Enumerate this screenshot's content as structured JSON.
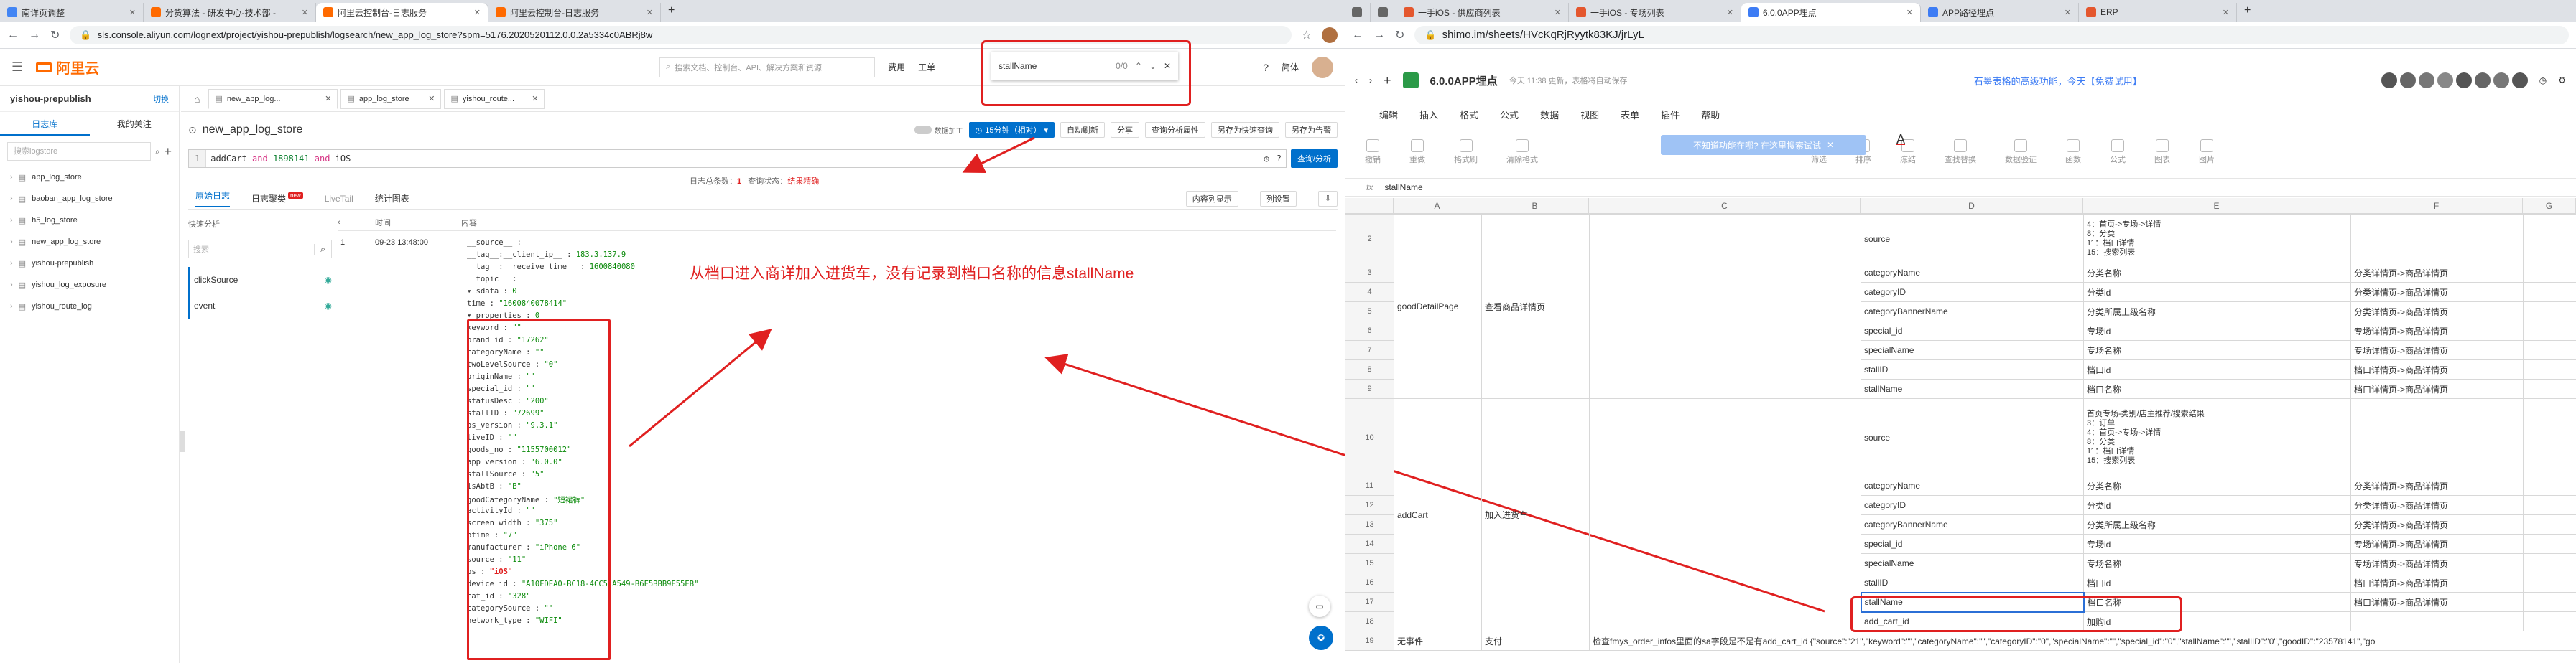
{
  "left": {
    "tabs": [
      {
        "label": "南详页调整",
        "color": "#4285f4"
      },
      {
        "label": "分货算法 - 研发中心-技术部 -",
        "color": "#ff6a00"
      },
      {
        "label": "阿里云控制台-日志服务",
        "color": "#ff6a00"
      },
      {
        "label": "阿里云控制台-日志服务",
        "color": "#ff6a00"
      }
    ],
    "url": "sls.console.aliyun.com/lognext/project/yishou-prepublish/logsearch/new_app_log_store?spm=5176.2020520112.0.0.2a5334c0ABRj8w",
    "brand": "阿里云",
    "search_placeholder": "搜索文档、控制台、API、解决方案和资源",
    "top_links": [
      "费用",
      "工单",
      "简体"
    ],
    "find": {
      "query": "stallName",
      "count": "0/0"
    },
    "project": "yishou-prepublish",
    "switch_label": "切换",
    "sidebar_tabs": [
      "日志库",
      "我的关注"
    ],
    "sidebar_search_placeholder": "搜索logstore",
    "logstores": [
      "app_log_store",
      "baoban_app_log_store",
      "h5_log_store",
      "new_app_log_store",
      "yishou-prepublish",
      "yishou_log_exposure",
      "yishou_route_log"
    ],
    "page_tabs": [
      "new_app_log...",
      "app_log_store",
      "yishou_route..."
    ],
    "logstore_title": "new_app_log_store",
    "toggle_label": "数据加工",
    "time_button": "15分钟（相对）",
    "toolbar": [
      "自动刷新",
      "分享",
      "查询分析属性",
      "另存为快速查询",
      "另存为告警"
    ],
    "query": {
      "line": "1",
      "parts": [
        {
          "t": "addCart",
          "c": "#333"
        },
        {
          "t": " and ",
          "c": "#d63384"
        },
        {
          "t": "1898141",
          "c": "#0a7f2e"
        },
        {
          "t": " and ",
          "c": "#d63384"
        },
        {
          "t": "iOS",
          "c": "#333"
        }
      ]
    },
    "search_button": "查询/分析",
    "stats": {
      "total_label": "日志总条数：",
      "total": "1",
      "status_label": "查询状态：",
      "status": "结果精确"
    },
    "result_tabs": [
      "原始日志",
      "日志聚类",
      "LiveTail",
      "统计图表"
    ],
    "new_badge": "new",
    "result_buttons": [
      "内容列显示",
      "列设置"
    ],
    "quick_analysis": "快速分析",
    "quick_search_placeholder": "搜索",
    "fields": [
      "clickSource",
      "event"
    ],
    "col_time": "时间",
    "col_content": "内容",
    "row_index": "1",
    "row_time": "09-23 13:48:00",
    "log_lines": [
      {
        "text": "__source__ :",
        "v": ""
      },
      {
        "text": "__tag__:__client_ip__ :",
        "v": "183.3.137.9"
      },
      {
        "text": "__tag__:__receive_time__ :",
        "v": "1600840080"
      },
      {
        "text": "__topic__ :",
        "v": ""
      },
      {
        "text": "▾ sdata :",
        "v": "0"
      },
      {
        "text": "   time :",
        "v": "\"1600840078414\""
      },
      {
        "text": "▾ properties :",
        "v": "0"
      },
      {
        "text": "   keyword :",
        "v": "\"\""
      },
      {
        "text": "   brand_id :",
        "v": "\"17262\""
      },
      {
        "text": "   categoryName :",
        "v": "\"\""
      },
      {
        "text": "   twoLevelSource :",
        "v": "\"0\""
      },
      {
        "text": "   originName :",
        "v": "\"\""
      },
      {
        "text": "   special_id :",
        "v": "\"\""
      },
      {
        "text": "   statusDesc :",
        "v": "\"200\""
      },
      {
        "text": "   stallID :",
        "v": "\"72699\""
      },
      {
        "text": "   os_version :",
        "v": "\"9.3.1\""
      },
      {
        "text": "   liveID :",
        "v": "\"\""
      },
      {
        "text": "   goods_no :",
        "v": "\"1155700012\""
      },
      {
        "text": "   app_version :",
        "v": "\"6.0.0\""
      },
      {
        "text": "   stallSource :",
        "v": "\"5\""
      },
      {
        "text": "   isAbtB :",
        "v": "\"B\""
      },
      {
        "text": "   goodCategoryName :",
        "v": "\"短裙裤\""
      },
      {
        "text": "   activityId :",
        "v": "\"\""
      },
      {
        "text": "   screen_width :",
        "v": "\"375\""
      },
      {
        "text": "   ptime :",
        "v": "\"7\""
      },
      {
        "text": "   manufacturer :",
        "v": "\"iPhone 6\""
      },
      {
        "text": "   source :",
        "v": "\"11\""
      },
      {
        "text": "   os :",
        "v": "\"iOS\""
      },
      {
        "text": "   device_id :",
        "v": "\"A10FDEA0-BC18-4CC5-A549-B6F5BBB9E55EB\""
      },
      {
        "text": "   cat_id :",
        "v": "\"328\""
      },
      {
        "text": "   categorySource :",
        "v": "\"\""
      },
      {
        "text": "   network_type :",
        "v": "\"WIFI\""
      }
    ],
    "annotation": "从档口进入商详加入进货车，没有记录到档口名称的信息stallName"
  },
  "right": {
    "tabs": [
      {
        "label": "",
        "color": "#666"
      },
      {
        "label": "",
        "color": "#666"
      },
      {
        "label": "一手iOS - 供应商列表",
        "color": "#e4572e"
      },
      {
        "label": "一手iOS - 专场列表",
        "color": "#e4572e"
      },
      {
        "label": "6.0.0APP埋点",
        "color": "#3d7cf4"
      },
      {
        "label": "APP路径埋点",
        "color": "#3d7cf4"
      },
      {
        "label": "ERP",
        "color": "#e4572e"
      }
    ],
    "url": "shimo.im/sheets/HVcKqRjRyytk83KJ/jrLyL",
    "doc_title": "6.0.0APP埋点",
    "saved_status": "今天 11:38 更新，表格将自动保存",
    "promo": "石墨表格的高级功能，今天【免费试用】",
    "menu": [
      "编辑",
      "插入",
      "格式",
      "公式",
      "数据",
      "视图",
      "表单",
      "插件",
      "帮助"
    ],
    "toolbar": [
      "撤销",
      "重做",
      "格式刷",
      "清除格式",
      "筛选",
      "排序",
      "冻结",
      "查找替换",
      "数据验证",
      "函数",
      "公式",
      "图表",
      "图片"
    ],
    "tooltip": "不知道功能在哪? 在这里搜索试试",
    "font": "A",
    "formula_label": "fx",
    "formula_value": "stallName",
    "col_headers": [
      "A",
      "B",
      "C",
      "D",
      "E",
      "F",
      "G"
    ],
    "rows": [
      {
        "n": "2",
        "d": "source",
        "e": "4：首页->专场->详情\n8：分类\n11：档口详情\n15：搜索列表",
        "f": ""
      },
      {
        "n": "3",
        "d": "categoryName",
        "e": "分类名称",
        "f": "分类详情页->商品详情页"
      },
      {
        "n": "4",
        "d": "categoryID",
        "e": "分类id",
        "f": "分类详情页->商品详情页"
      },
      {
        "n": "5",
        "d": "categoryBannerName",
        "e": "分类所属上级名称",
        "f": "分类详情页->商品详情页"
      },
      {
        "n": "6",
        "d": "special_id",
        "e": "专场id",
        "f": "专场详情页->商品详情页"
      },
      {
        "n": "7",
        "d": "specialName",
        "e": "专场名称",
        "f": "专场详情页->商品详情页"
      },
      {
        "n": "8",
        "d": "stallID",
        "e": "档口id",
        "f": "档口详情页->商品详情页"
      },
      {
        "n": "9",
        "d": "stallName",
        "e": "档口名称",
        "f": "档口详情页->商品详情页"
      },
      {
        "n": "10",
        "d": "source",
        "e": "首页专场-类别/店主推荐/搜索结果\n3：订单\n4：首页->专场->详情\n8：分类\n11：档口详情\n15：搜索列表",
        "f": ""
      },
      {
        "n": "11",
        "d": "categoryName",
        "e": "分类名称",
        "f": "分类详情页->商品详情页"
      },
      {
        "n": "12",
        "d": "categoryID",
        "e": "分类id",
        "f": "分类详情页->商品详情页"
      },
      {
        "n": "13",
        "d": "categoryBannerName",
        "e": "分类所属上级名称",
        "f": "分类详情页->商品详情页"
      },
      {
        "n": "14",
        "d": "special_id",
        "e": "专场id",
        "f": "专场详情页->商品详情页"
      },
      {
        "n": "15",
        "d": "specialName",
        "e": "专场名称",
        "f": "专场详情页->商品详情页"
      },
      {
        "n": "16",
        "d": "stallID",
        "e": "档口id",
        "f": "档口详情页->商品详情页"
      },
      {
        "n": "17",
        "d": "stallName",
        "e": "档口名称",
        "f": "档口详情页->商品详情页"
      },
      {
        "n": "18",
        "d": "add_cart_id",
        "e": "加购id",
        "f": ""
      },
      {
        "n": "19",
        "d": "",
        "e": "",
        "f": ""
      }
    ],
    "group1": {
      "a": "goodDetailPage",
      "b": "查看商品详情页"
    },
    "group2": {
      "a": "addCart",
      "b": "加入进货车"
    },
    "row19": {
      "a": "无事件",
      "b": "支付",
      "c": "检查fmys_order_infos里面的sa字段是不是有add_cart_id {\"source\":\"21\",\"keyword\":\"\",\"categoryName\":\"\",\"categoryID\":\"0\",\"specialName\":\"\",\"special_id\":\"0\",\"stallName\":\"\",\"stallID\":\"0\",\"goodID\":\"23578141\",\"go"
    }
  }
}
